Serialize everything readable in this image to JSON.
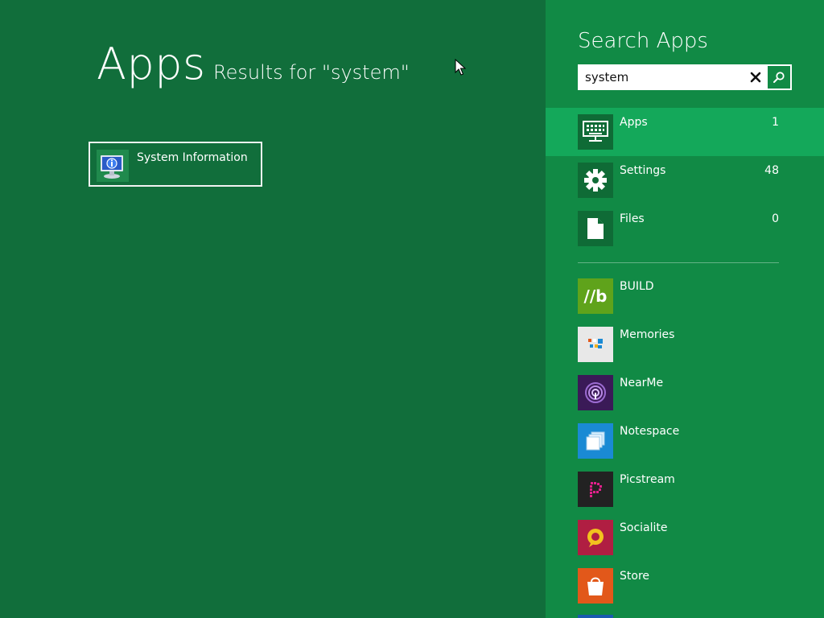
{
  "main": {
    "title": "Apps",
    "results_for": "Results for \"system\"",
    "results": [
      {
        "label": "System Information",
        "icon": "system-information-icon"
      }
    ]
  },
  "pane": {
    "title": "Search Apps",
    "search": {
      "value": "system",
      "placeholder": ""
    },
    "categories": [
      {
        "label": "Apps",
        "count": "1",
        "icon": "keyboard-monitor-icon",
        "selected": true
      },
      {
        "label": "Settings",
        "count": "48",
        "icon": "gear-icon",
        "selected": false
      },
      {
        "label": "Files",
        "count": "0",
        "icon": "file-icon",
        "selected": false
      }
    ],
    "apps": [
      {
        "label": "BUILD",
        "icon_text": "//b",
        "color": "#5fa31b"
      },
      {
        "label": "Memories",
        "color": "#e8e8e8"
      },
      {
        "label": "NearMe",
        "color": "#3a1a57"
      },
      {
        "label": "Notespace",
        "color": "#1a8ad4"
      },
      {
        "label": "Picstream",
        "color": "#222222"
      },
      {
        "label": "Socialite",
        "color": "#b01e42"
      },
      {
        "label": "Store",
        "color": "#e2581a"
      }
    ]
  },
  "colors": {
    "main_bg": "#116e3b",
    "pane_bg": "#118a45",
    "selected_bg": "#14a85a"
  }
}
